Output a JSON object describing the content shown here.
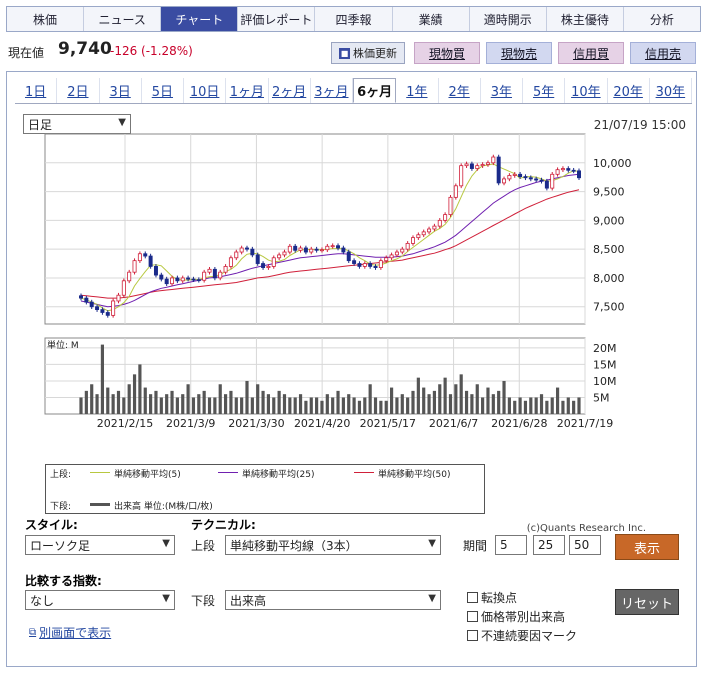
{
  "nav": {
    "tabs": [
      {
        "label": "株価"
      },
      {
        "label": "ニュース"
      },
      {
        "label": "チャート"
      },
      {
        "label": "評価レポート"
      },
      {
        "label": "四季報"
      },
      {
        "label": "業績"
      },
      {
        "label": "適時開示"
      },
      {
        "label": "株主優待"
      },
      {
        "label": "分析"
      }
    ],
    "active_index": 2
  },
  "quote": {
    "label": "現在値",
    "price": "9,740",
    "change": "-126 (-1.28%)",
    "update_button": "株価更新",
    "buy_spot": "現物買",
    "sell_spot": "現物売",
    "buy_margin": "信用買",
    "sell_margin": "信用売"
  },
  "periods": [
    "1日",
    "2日",
    "3日",
    "5日",
    "10日",
    "1ヶ月",
    "2ヶ月",
    "3ヶ月",
    "6ヶ月",
    "1年",
    "2年",
    "3年",
    "5年",
    "10年",
    "20年",
    "30年"
  ],
  "period_active_index": 8,
  "chart": {
    "interval_select": "日足",
    "timestamp": "21/07/19 15:00",
    "volume_unit_label": "単位: M",
    "copyright": "(c)Quants Research Inc.",
    "legend": {
      "upper_label": "上段:",
      "lower_label": "下段:",
      "ma5": "単純移動平均(5)",
      "ma25": "単純移動平均(25)",
      "ma50": "単純移動平均(50)",
      "volume": "出来高 単位:(M株/口/枚)"
    }
  },
  "chart_data": {
    "type": "candlestick",
    "price_axis": {
      "ticks": [
        "10,000",
        "9,500",
        "9,000",
        "8,500",
        "8,000",
        "7,500"
      ],
      "ylim": [
        7200,
        10500
      ]
    },
    "volume_axis": {
      "ticks": [
        "20M",
        "15M",
        "10M",
        "5M"
      ],
      "ylim": [
        0,
        23
      ]
    },
    "x_tick_labels": [
      "2021/2/15",
      "2021/3/9",
      "2021/3/30",
      "2021/4/20",
      "2021/5/17",
      "2021/6/7",
      "2021/6/28",
      "2021/7/19"
    ],
    "close": [
      7650,
      7580,
      7500,
      7450,
      7400,
      7350,
      7600,
      7700,
      7950,
      8100,
      8300,
      8420,
      8380,
      8200,
      8050,
      7980,
      7900,
      8000,
      7950,
      8000,
      7980,
      7970,
      7960,
      8100,
      8150,
      8000,
      8100,
      8200,
      8350,
      8450,
      8520,
      8500,
      8400,
      8250,
      8180,
      8200,
      8350,
      8400,
      8450,
      8550,
      8480,
      8520,
      8450,
      8500,
      8480,
      8490,
      8550,
      8560,
      8520,
      8450,
      8300,
      8250,
      8200,
      8250,
      8200,
      8180,
      8300,
      8350,
      8400,
      8450,
      8500,
      8600,
      8700,
      8750,
      8800,
      8850,
      8900,
      9000,
      9100,
      9400,
      9600,
      9950,
      9980,
      9900,
      9950,
      9970,
      10000,
      10100,
      9650,
      9720,
      9780,
      9800,
      9760,
      9740,
      9720,
      9700,
      9680,
      9560,
      9800,
      9880,
      9900,
      9870,
      9860,
      9740
    ],
    "ma5": [
      7650,
      7620,
      7580,
      7540,
      7480,
      7430,
      7450,
      7500,
      7570,
      7680,
      7860,
      7990,
      8110,
      8220,
      8230,
      8210,
      8120,
      8030,
      7970,
      7970,
      7960,
      7980,
      7970,
      8000,
      8020,
      8030,
      8060,
      8110,
      8150,
      8220,
      8330,
      8410,
      8430,
      8420,
      8370,
      8310,
      8280,
      8290,
      8320,
      8390,
      8440,
      8490,
      8490,
      8500,
      8490,
      8490,
      8500,
      8510,
      8510,
      8510,
      8470,
      8420,
      8350,
      8300,
      8240,
      8220,
      8230,
      8260,
      8300,
      8330,
      8380,
      8460,
      8530,
      8600,
      8670,
      8740,
      8810,
      8860,
      8930,
      9050,
      9200,
      9410,
      9610,
      9770,
      9880,
      9950,
      9960,
      9980,
      9930,
      9890,
      9850,
      9810,
      9730,
      9760,
      9760,
      9750,
      9720,
      9680,
      9690,
      9720,
      9760,
      9820,
      9860,
      9850
    ],
    "ma25": [
      7600,
      7580,
      7560,
      7540,
      7520,
      7500,
      7510,
      7520,
      7540,
      7570,
      7610,
      7660,
      7710,
      7760,
      7790,
      7820,
      7840,
      7860,
      7880,
      7900,
      7920,
      7940,
      7960,
      7980,
      8000,
      8010,
      8020,
      8040,
      8060,
      8080,
      8110,
      8140,
      8170,
      8190,
      8210,
      8230,
      8250,
      8270,
      8290,
      8310,
      8330,
      8350,
      8360,
      8370,
      8380,
      8390,
      8400,
      8410,
      8420,
      8420,
      8410,
      8400,
      8390,
      8380,
      8370,
      8360,
      8360,
      8360,
      8360,
      8370,
      8380,
      8400,
      8420,
      8450,
      8480,
      8510,
      8540,
      8580,
      8620,
      8680,
      8740,
      8820,
      8900,
      8980,
      9060,
      9140,
      9220,
      9300,
      9360,
      9420,
      9480,
      9530,
      9570,
      9600,
      9630,
      9660,
      9680,
      9700,
      9720,
      9740,
      9760,
      9780,
      9790,
      9800
    ],
    "ma50": [
      7700,
      7690,
      7680,
      7670,
      7660,
      7650,
      7650,
      7650,
      7660,
      7670,
      7690,
      7710,
      7730,
      7750,
      7770,
      7780,
      7790,
      7800,
      7810,
      7820,
      7830,
      7840,
      7850,
      7860,
      7870,
      7880,
      7890,
      7900,
      7910,
      7920,
      7940,
      7960,
      7980,
      8000,
      8010,
      8020,
      8040,
      8060,
      8080,
      8100,
      8110,
      8120,
      8130,
      8140,
      8150,
      8160,
      8170,
      8180,
      8190,
      8200,
      8210,
      8220,
      8230,
      8240,
      8250,
      8260,
      8270,
      8280,
      8290,
      8300,
      8310,
      8330,
      8350,
      8370,
      8390,
      8410,
      8430,
      8460,
      8490,
      8520,
      8560,
      8610,
      8660,
      8710,
      8760,
      8810,
      8860,
      8910,
      8960,
      9010,
      9060,
      9110,
      9160,
      9210,
      9250,
      9290,
      9330,
      9370,
      9400,
      9430,
      9460,
      9490,
      9510,
      9530
    ],
    "volume": [
      5,
      7,
      9,
      6,
      21,
      8,
      6,
      7,
      5,
      9,
      12,
      15,
      8,
      6,
      7,
      5,
      6,
      7,
      5,
      6,
      9,
      5,
      6,
      7,
      5,
      5,
      9,
      6,
      7,
      5,
      5,
      10,
      5,
      9,
      7,
      6,
      5,
      7,
      6,
      5,
      5,
      6,
      4,
      5,
      5,
      4,
      6,
      5,
      7,
      5,
      6,
      5,
      4,
      5,
      9,
      5,
      4,
      4,
      8,
      5,
      6,
      5,
      7,
      11,
      8,
      6,
      7,
      9,
      11,
      6,
      9,
      12,
      7,
      6,
      9,
      5,
      8,
      6,
      7,
      10,
      5,
      4,
      5,
      4,
      5,
      5,
      6,
      4,
      5,
      8,
      4,
      5,
      4,
      5
    ]
  },
  "controls": {
    "style_label": "スタイル:",
    "style_value": "ローソク足",
    "technical_label": "テクニカル:",
    "upper_label": "上段",
    "upper_value": "単純移動平均線（3本）",
    "lower_label": "下段",
    "lower_value": "出来高",
    "period_label": "期間",
    "period_values": [
      "5",
      "25",
      "50"
    ],
    "show_button": "表示",
    "reset_button": "リセット",
    "compare_label": "比較する指数:",
    "compare_value": "なし",
    "checkboxes": [
      "転換点",
      "価格帯別出来高",
      "不連続要因マーク"
    ],
    "new_window_link": "別画面で表示"
  }
}
